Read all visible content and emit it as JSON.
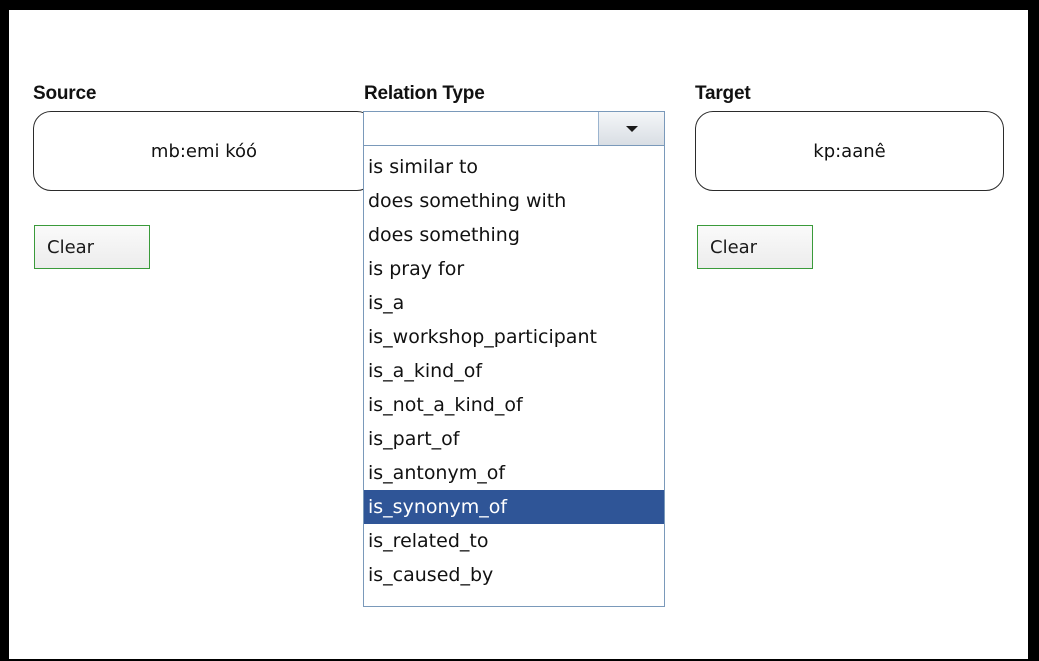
{
  "source": {
    "title": "Source",
    "value": "mb:emi kóó",
    "clear_label": "Clear"
  },
  "relation": {
    "title": "Relation Type",
    "selected_value": "",
    "options": [
      "is similar to",
      "does something with",
      "does something",
      "is pray for",
      "is_a",
      "is_workshop_participant",
      "is_a_kind_of",
      "is_not_a_kind_of",
      "is_part_of",
      "is_antonym_of",
      "is_synonym_of",
      "is_related_to",
      "is_caused_by"
    ],
    "highlighted_option": "is_synonym_of"
  },
  "target": {
    "title": "Target",
    "value": "kp:aanê",
    "clear_label": "Clear"
  },
  "colors": {
    "highlight": "#2f5597",
    "button_border": "#3a9a3a",
    "select_border": "#7a99ba"
  },
  "icons": {
    "dropdown": "chevron-down-icon"
  }
}
